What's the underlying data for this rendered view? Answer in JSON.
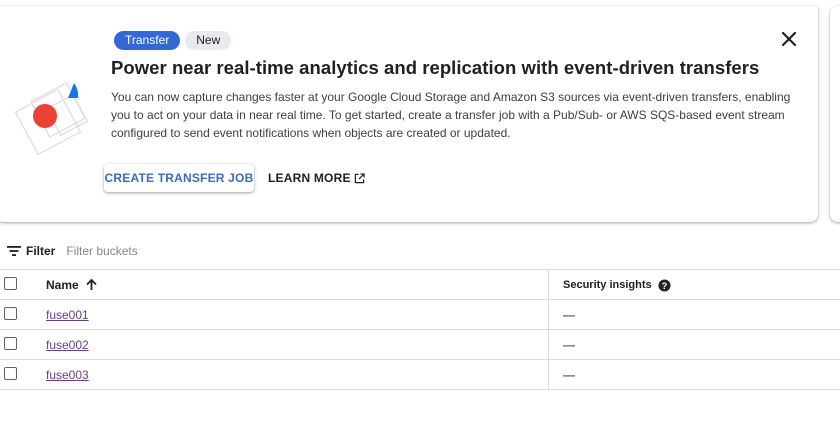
{
  "banner": {
    "chips": [
      "Transfer",
      "New"
    ],
    "headline": "Power near real-time analytics and replication with event-driven transfers",
    "description": "You can now capture changes faster at your Google Cloud Storage and Amazon S3 sources via event-driven transfers, enabling you to act on your data in near real time. To get started, create a transfer job with a Pub/Sub- or AWS SQS-based event stream configured to send event notifications when objects are created or updated.",
    "create_button": "CREATE TRANSFER JOB",
    "learn_more": "LEARN MORE"
  },
  "filter": {
    "label": "Filter",
    "placeholder": "Filter buckets"
  },
  "table": {
    "columns": {
      "name": "Name",
      "security": "Security insights"
    },
    "rows": [
      {
        "name": "fuse001",
        "security": "—"
      },
      {
        "name": "fuse002",
        "security": "—"
      },
      {
        "name": "fuse003",
        "security": "—"
      }
    ]
  },
  "icons": {
    "close": "close-icon",
    "external_link": "open-in-new-icon",
    "filter": "filter-list-icon",
    "sort": "arrow-upward-icon",
    "help": "help-icon"
  },
  "colors": {
    "chip_primary": "#3367d6",
    "chip_secondary": "#e8eaed",
    "link": "#6a3d8f",
    "primary_text_button": "#3c6bbd",
    "illustration_red": "#ea4335",
    "illustration_blue": "#1a73e8"
  }
}
